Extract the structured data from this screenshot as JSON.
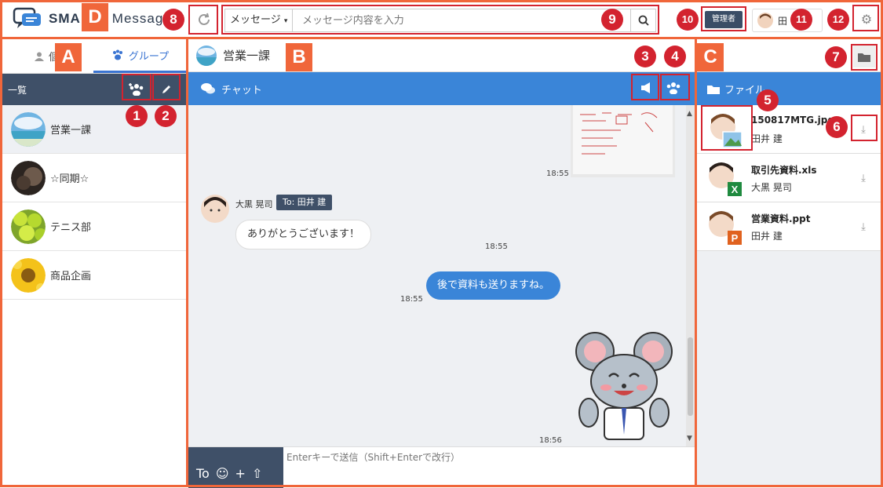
{
  "header": {
    "logo_bold": "SMA",
    "logo_rest": "Messag",
    "search_scope": "メッセージ",
    "search_placeholder": "メッセージ内容を入力",
    "admin_label": "管理者",
    "user_name": "田"
  },
  "left": {
    "tab_personal": "個",
    "tab_group": "グループ",
    "list_title": "一覧",
    "groups": [
      {
        "name": "営業一課"
      },
      {
        "name": "☆同期☆"
      },
      {
        "name": "テニス部"
      },
      {
        "name": "商品企画"
      }
    ]
  },
  "center": {
    "room_name": "営業一課",
    "chat_label": "チャット",
    "messages": [
      {
        "time": "18:55"
      },
      {
        "sender": "大黒 晃司",
        "to": "To: 田井 建",
        "text": "ありがとうございます！",
        "time": "18:55"
      },
      {
        "text": "後で資料も送りますね。",
        "time": "18:55"
      },
      {
        "time": "18:56"
      }
    ],
    "composer_placeholder": "Enterキーで送信（Shift+Enterで改行）",
    "composer_to": "To"
  },
  "right": {
    "file_label": "ファイル",
    "files": [
      {
        "name": "150817MTG.jpg",
        "owner": "田井 建",
        "type": "image"
      },
      {
        "name": "取引先資料.xls",
        "owner": "大黒 晃司",
        "type": "X"
      },
      {
        "name": "営業資料.ppt",
        "owner": "田井 建",
        "type": "P"
      }
    ]
  },
  "annotations": {
    "letters": [
      "A",
      "B",
      "C",
      "D"
    ],
    "numbers": [
      "1",
      "2",
      "3",
      "4",
      "5",
      "6",
      "7",
      "8",
      "9",
      "10",
      "11",
      "12"
    ]
  },
  "colors": {
    "accent_orange": "#f0663a",
    "annotation_red": "#d3232f",
    "primary_blue": "#3a85d8",
    "dark_slate": "#3f5068"
  }
}
